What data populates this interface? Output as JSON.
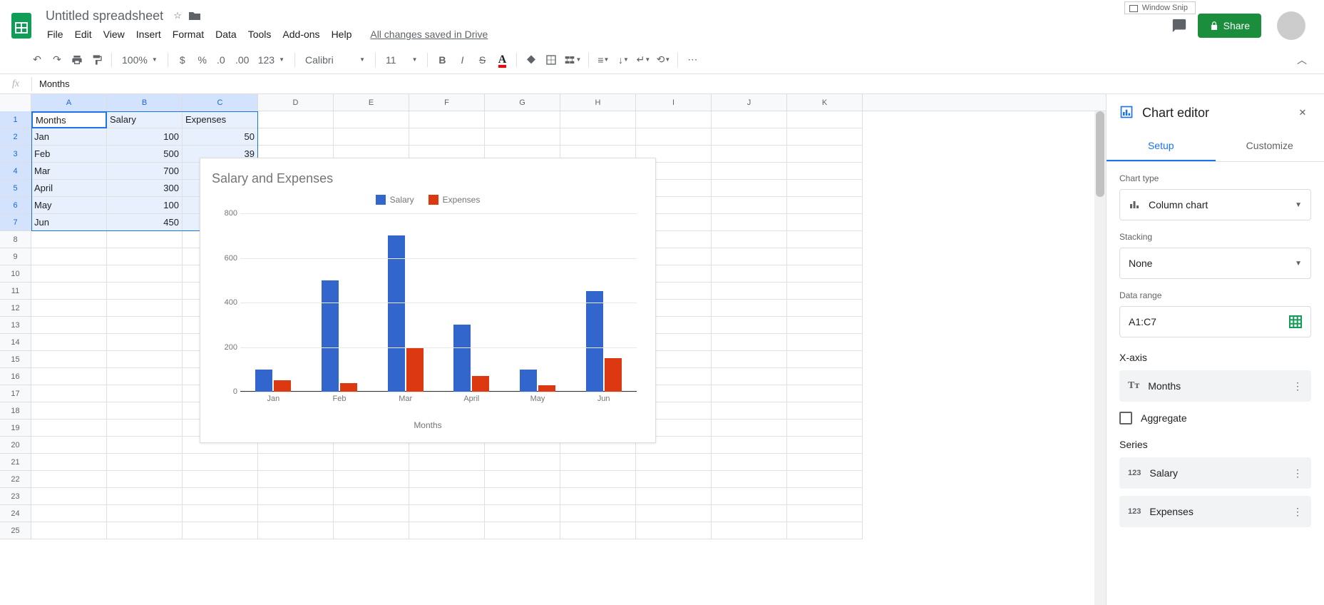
{
  "doc_title": "Untitled spreadsheet",
  "menu": {
    "file": "File",
    "edit": "Edit",
    "view": "View",
    "insert": "Insert",
    "format": "Format",
    "data": "Data",
    "tools": "Tools",
    "addons": "Add-ons",
    "help": "Help"
  },
  "save_status": "All changes saved in Drive",
  "share_label": "Share",
  "win_snip": "Window Snip",
  "toolbar": {
    "zoom": "100%",
    "font": "Calibri",
    "size": "11",
    "numfmt": "123"
  },
  "formula_value": "Months",
  "columns": [
    "A",
    "B",
    "C",
    "D",
    "E",
    "F",
    "G",
    "H",
    "I",
    "J",
    "K"
  ],
  "selected_cols": [
    "A",
    "B",
    "C"
  ],
  "active_cell": "A1",
  "row_count": 25,
  "selected_rows": [
    1,
    2,
    3,
    4,
    5,
    6,
    7
  ],
  "table": {
    "headers": [
      "Months",
      "Salary",
      "Expenses"
    ],
    "rows": [
      {
        "month": "Jan",
        "salary": 100,
        "expenses": 50
      },
      {
        "month": "Feb",
        "salary": 500,
        "expenses": 39
      },
      {
        "month": "Mar",
        "salary": 700,
        "expenses": ""
      },
      {
        "month": "April",
        "salary": 300,
        "expenses": ""
      },
      {
        "month": "May",
        "salary": 100,
        "expenses": ""
      },
      {
        "month": "Jun",
        "salary": 450,
        "expenses": ""
      }
    ]
  },
  "chart_data": {
    "type": "bar",
    "title": "Salary and Expenses",
    "xlabel": "Months",
    "ylabel": "",
    "categories": [
      "Jan",
      "Feb",
      "Mar",
      "April",
      "May",
      "Jun"
    ],
    "series": [
      {
        "name": "Salary",
        "color": "#3366cc",
        "values": [
          100,
          500,
          700,
          300,
          100,
          450
        ]
      },
      {
        "name": "Expenses",
        "color": "#dc3912",
        "values": [
          50,
          39,
          200,
          70,
          30,
          150
        ]
      }
    ],
    "ylim": [
      0,
      800
    ],
    "yticks": [
      0,
      200,
      400,
      600,
      800
    ]
  },
  "editor": {
    "title": "Chart editor",
    "tab_setup": "Setup",
    "tab_customize": "Customize",
    "chart_type_label": "Chart type",
    "chart_type_value": "Column chart",
    "stacking_label": "Stacking",
    "stacking_value": "None",
    "data_range_label": "Data range",
    "data_range_value": "A1:C7",
    "xaxis_label": "X-axis",
    "xaxis_value": "Months",
    "aggregate_label": "Aggregate",
    "series_label": "Series",
    "series_values": [
      "Salary",
      "Expenses"
    ]
  }
}
